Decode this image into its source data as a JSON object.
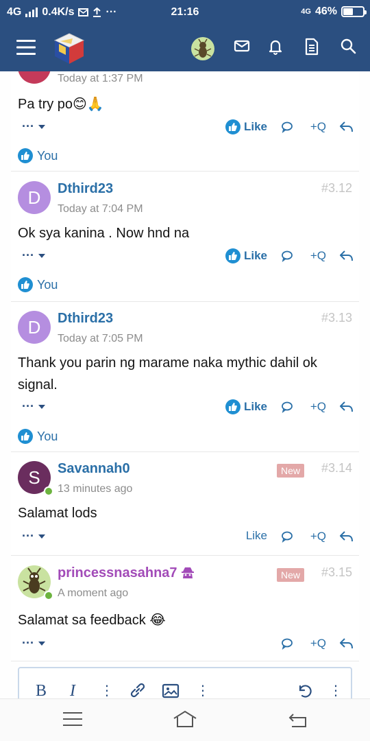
{
  "status_bar": {
    "network": "4G",
    "speed": "0.4K/s",
    "time": "21:16",
    "network_right": "4G",
    "battery_percent": "46%",
    "battery_level": 0.46
  },
  "header": {
    "menu_icon": "hamburger-menu-icon",
    "logo_icon": "site-logo-cube",
    "avatar_icon": "user-avatar",
    "inbox_icon": "envelope-icon",
    "alerts_icon": "bell-icon",
    "whats_new_icon": "document-icon",
    "search_icon": "search-icon"
  },
  "posts": [
    {
      "id": "partial",
      "timestamp": "Today at 1:37 PM",
      "message": "Pa try po",
      "emoji": "😊🙏",
      "like_label": "Like",
      "quote_label": "+Q",
      "reaction_label": "You"
    },
    {
      "id": "3.12",
      "avatar_letter": "D",
      "username": "Dthird23",
      "timestamp": "Today at 7:04 PM",
      "post_number": "#3.12",
      "message": "Ok sya kanina . Now hnd na",
      "like_label": "Like",
      "quote_label": "+Q",
      "reaction_label": "You"
    },
    {
      "id": "3.13",
      "avatar_letter": "D",
      "username": "Dthird23",
      "timestamp": "Today at 7:05 PM",
      "post_number": "#3.13",
      "message": "Thank you parin ng marame naka mythic dahil ok signal.",
      "like_label": "Like",
      "quote_label": "+Q",
      "reaction_label": "You"
    },
    {
      "id": "3.14",
      "avatar_letter": "S",
      "username": "Savannah0",
      "timestamp": "13 minutes ago",
      "post_number": "#3.14",
      "badge": "New",
      "message": "Salamat lods",
      "like_label": "Like",
      "quote_label": "+Q"
    },
    {
      "id": "3.15",
      "username": "princessnasahna7",
      "timestamp": "A moment ago",
      "post_number": "#3.15",
      "badge": "New",
      "message": "Salamat sa feedback",
      "emoji": "😂",
      "quote_label": "+Q"
    }
  ],
  "editor": {
    "bold_label": "B",
    "italic_label": "I"
  },
  "colors": {
    "header_bg": "#2b4f80",
    "link": "#2a6fa7",
    "badge_new": "#e3a8a8",
    "online": "#6cb33f"
  }
}
